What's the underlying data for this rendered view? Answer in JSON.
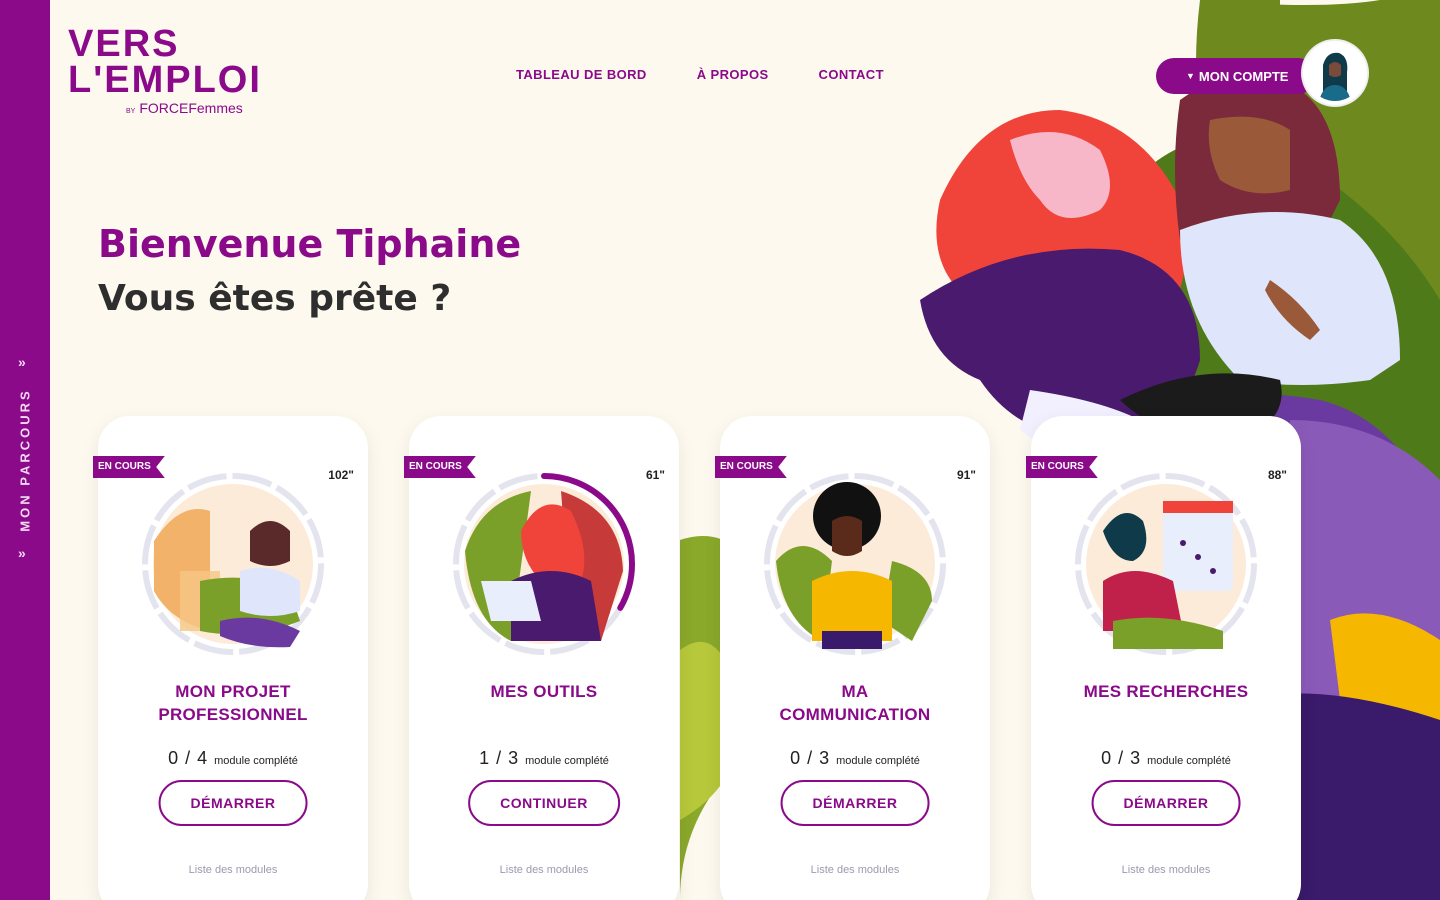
{
  "sidebar": {
    "label": "MON PARCOURS",
    "chevron": "»"
  },
  "logo": {
    "line1": "VERS",
    "line2": "L'EMPLOI",
    "by_prefix": "BY",
    "by_name": "FORCEFemmes"
  },
  "nav": {
    "items": [
      "TABLEAU DE BORD",
      "À PROPOS",
      "CONTACT"
    ]
  },
  "account": {
    "label": "MON COMPTE",
    "icon": "chevron-down-icon"
  },
  "hero": {
    "welcome": "Bienvenue Tiphaine",
    "subtitle": "Vous êtes prête ?"
  },
  "colors": {
    "brand": "#8a0a8a",
    "background": "#fdf9ef",
    "ring_track": "#e4e4ef"
  },
  "cards": [
    {
      "badge": "EN COURS",
      "duration": "102\"",
      "title_l1": "MON PROJET",
      "title_l2": "PROFESSIONNEL",
      "progress": "0 / 4",
      "progress_label": "module complété",
      "progress_ratio": 0,
      "button": "DÉMARRER",
      "link": "Liste des modules"
    },
    {
      "badge": "EN COURS",
      "duration": "61\"",
      "title_l1": "MES OUTILS",
      "title_l2": "",
      "progress": "1 / 3",
      "progress_label": "module complété",
      "progress_ratio": 0.333,
      "button": "CONTINUER",
      "link": "Liste des modules"
    },
    {
      "badge": "EN COURS",
      "duration": "91\"",
      "title_l1": "MA",
      "title_l2": "COMMUNICATION",
      "progress": "0 / 3",
      "progress_label": "module complété",
      "progress_ratio": 0,
      "button": "DÉMARRER",
      "link": "Liste des modules"
    },
    {
      "badge": "EN COURS",
      "duration": "88\"",
      "title_l1": "MES RECHERCHES",
      "title_l2": "",
      "progress": "0 / 3",
      "progress_label": "module complété",
      "progress_ratio": 0,
      "button": "DÉMARRER",
      "link": "Liste des modules"
    }
  ]
}
